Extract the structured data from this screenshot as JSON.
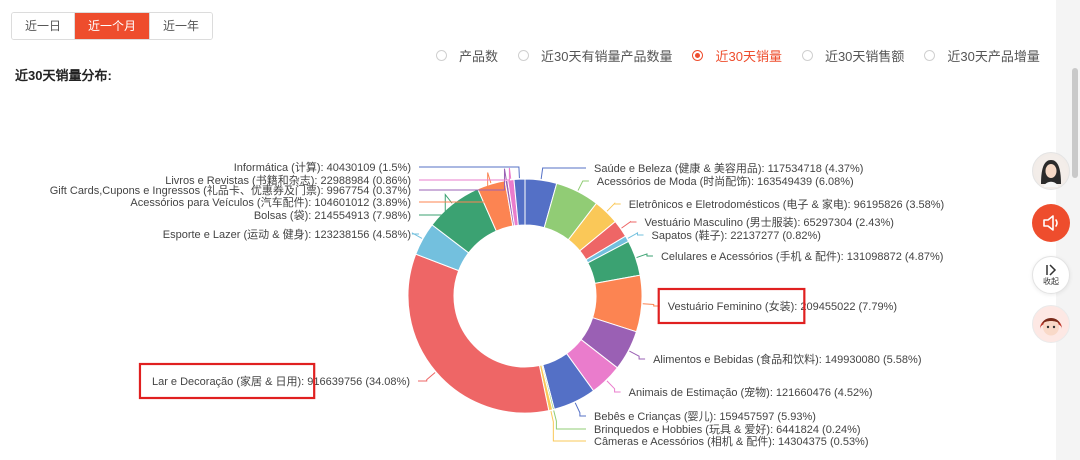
{
  "tabs": [
    {
      "label": "近一日",
      "active": false
    },
    {
      "label": "近一个月",
      "active": true
    },
    {
      "label": "近一年",
      "active": false
    }
  ],
  "metrics": [
    {
      "label": "产品数",
      "checked": false
    },
    {
      "label": "近30天有销量产品数量",
      "checked": false
    },
    {
      "label": "近30天销量",
      "checked": true
    },
    {
      "label": "近30天销售额",
      "checked": false
    },
    {
      "label": "近30天产品增量",
      "checked": false
    }
  ],
  "section_title": "近30天销量分布:",
  "sidebar": {
    "collapse_label": "收起"
  },
  "colors": {
    "accent": "#ee4d2d",
    "highlight_box": "#e02020"
  },
  "chart_data": {
    "type": "pie",
    "donut": true,
    "start": "top",
    "direction": "clockwise",
    "highlighted": [
      "Vestuário Feminino (女装)",
      "Lar e Decoração (家居 & 日用)"
    ],
    "slices": [
      {
        "name": "Saúde e Beleza (健康 & 美容用品)",
        "value": 117534718,
        "pct": "4.37%",
        "color": "#5470c6"
      },
      {
        "name": "Acessórios de Moda (时尚配饰)",
        "value": 163549439,
        "pct": "6.08%",
        "color": "#91cc75"
      },
      {
        "name": "Eletrônicos e Eletrodomésticos (电子 & 家电)",
        "value": 96195826,
        "pct": "3.58%",
        "color": "#fac858"
      },
      {
        "name": "Vestuário Masculino (男士服装)",
        "value": 65297304,
        "pct": "2.43%",
        "color": "#ee6666"
      },
      {
        "name": "Sapatos (鞋子)",
        "value": 22137277,
        "pct": "0.82%",
        "color": "#73c0de"
      },
      {
        "name": "Celulares e Acessórios (手机 & 配件)",
        "value": 131098872,
        "pct": "4.87%",
        "color": "#3ba272"
      },
      {
        "name": "Vestuário Feminino (女装)",
        "value": 209455022,
        "pct": "7.79%",
        "color": "#fc8452"
      },
      {
        "name": "Alimentos e Bebidas (食品和饮料)",
        "value": 149930080,
        "pct": "5.58%",
        "color": "#9a60b4"
      },
      {
        "name": "Animais de Estimação (宠物)",
        "value": 121660476,
        "pct": "4.52%",
        "color": "#ea7ccc"
      },
      {
        "name": "Bebês e Crianças (婴儿)",
        "value": 159457597,
        "pct": "5.93%",
        "color": "#5470c6"
      },
      {
        "name": "Brinquedos e Hobbies (玩具 & 爱好)",
        "value": 6441824,
        "pct": "0.24%",
        "color": "#91cc75"
      },
      {
        "name": "Câmeras e Acessórios (相机 & 配件)",
        "value": 14304375,
        "pct": "0.53%",
        "color": "#fac858"
      },
      {
        "name": "Lar e Decoração (家居 & 日用)",
        "value": 916639756,
        "pct": "34.08%",
        "color": "#ee6666"
      },
      {
        "name": "Esporte e Lazer (运动 & 健身)",
        "value": 123238156,
        "pct": "4.58%",
        "color": "#73c0de"
      },
      {
        "name": "Bolsas (袋)",
        "value": 214554913,
        "pct": "7.98%",
        "color": "#3ba272"
      },
      {
        "name": "Acessórios para Veículos (汽车配件)",
        "value": 104601012,
        "pct": "3.89%",
        "color": "#fc8452"
      },
      {
        "name": "Gift Cards,Cupons e Ingressos (礼品卡、优惠券及门票)",
        "value": 9967754,
        "pct": "0.37%",
        "color": "#9a60b4"
      },
      {
        "name": "Livros e Revistas (书籍和杂志)",
        "value": 22988984,
        "pct": "0.86%",
        "color": "#ea7ccc"
      },
      {
        "name": "Informática (计算)",
        "value": 40430109,
        "pct": "1.5%",
        "color": "#5470c6"
      }
    ]
  }
}
